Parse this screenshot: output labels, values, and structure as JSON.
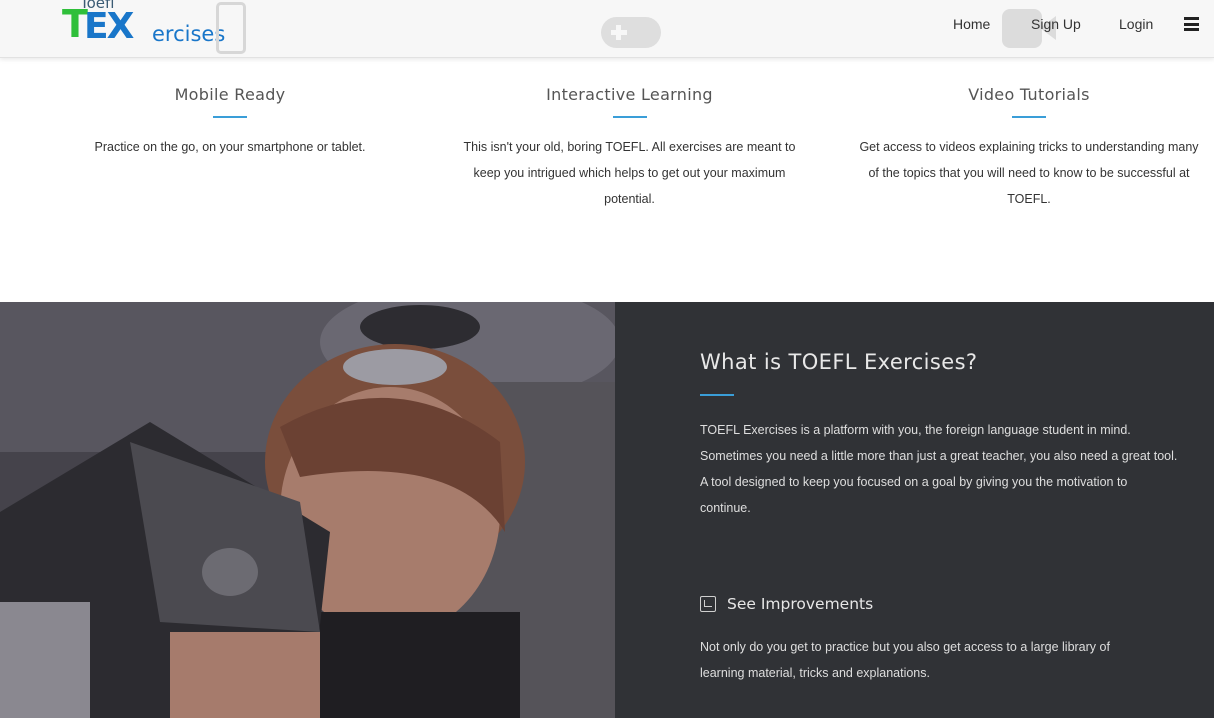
{
  "header": {
    "logo": {
      "small": "Toefl",
      "big_t": "T",
      "big_ex": "EX",
      "suffix": "ercises"
    },
    "nav": {
      "home": "Home",
      "signup": "Sign Up",
      "login": "Login"
    },
    "menu_icon": "hamburger-icon"
  },
  "features": [
    {
      "title": "Mobile Ready",
      "description": "Practice on the go, on your smartphone or tablet.",
      "icon": "mobile-icon"
    },
    {
      "title": "Interactive Learning",
      "description": "This isn't your old, boring TOEFL. All exercises are meant to keep you intrigued which helps to get out your maximum potential.",
      "icon": "gamepad-icon"
    },
    {
      "title": "Video Tutorials",
      "description": "Get access to videos explaining tricks to understanding many of the topics that you will need to know to be successful at TOEFL.",
      "icon": "video-icon"
    }
  ],
  "about": {
    "title": "What is TOEFL Exercises?",
    "text": "TOEFL Exercises is a platform with you, the foreign language student in mind. Sometimes you need a little more than just a great teacher, you also need a great tool. A tool designed to keep you focused on a goal by giving you the motivation to continue.",
    "improvements": {
      "icon": "translate-icon",
      "title": "See Improvements",
      "text": "Not only do you get to practice but you also get access to a large library of learning material, tricks and explanations."
    }
  },
  "colors": {
    "accent": "#3a9ed8",
    "dark_panel": "#303236",
    "logo_green": "#2fbf3a",
    "logo_blue": "#1976c9"
  }
}
